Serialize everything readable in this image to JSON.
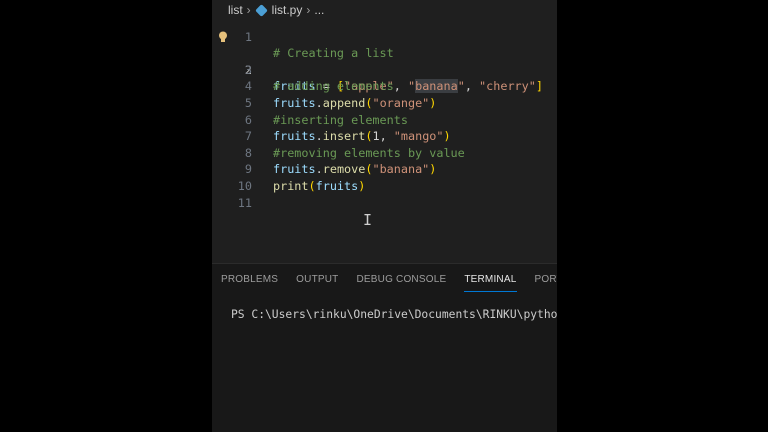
{
  "breadcrumb": {
    "folder": "list",
    "file": "list.py",
    "more": "..."
  },
  "editor": {
    "lines": [
      {
        "number": "1",
        "code": "# Creating a list"
      },
      {
        "number": "2",
        "code": "fruits = [\"apple\", \"banana\", \"cherry\"]"
      },
      {
        "number": "3",
        "code": "# adding elements"
      },
      {
        "number": "4",
        "code": "fruits.append(\"orange\")"
      },
      {
        "number": "5",
        "code": "#inserting elements"
      },
      {
        "number": "6",
        "code": "fruits.insert(1, \"mango\")"
      },
      {
        "number": "7",
        "code": "#removing elements by value"
      },
      {
        "number": "8",
        "code": "fruits.remove(\"banana\")"
      },
      {
        "number": "9",
        "code": "print(fruits)"
      },
      {
        "number": "10",
        "code": ""
      },
      {
        "number": "11",
        "code": ""
      }
    ],
    "active_line": "2",
    "lightbulb_icon": "lightbulb-icon",
    "text_cursor_icon": "i-beam-cursor-icon"
  },
  "panel": {
    "tabs": [
      "PROBLEMS",
      "OUTPUT",
      "DEBUG CONSOLE",
      "TERMINAL",
      "PORTS"
    ],
    "active_tab": "TERMINAL",
    "terminal_prompt": "PS C:\\Users\\rinku\\OneDrive\\Documents\\RINKU\\python>"
  },
  "colors": {
    "editor_background": "#1f1f1f",
    "comment": "#6a9955",
    "string": "#ce9178",
    "variable": "#9cdcfe",
    "function": "#dcdcaa",
    "accent": "#0078d4"
  }
}
